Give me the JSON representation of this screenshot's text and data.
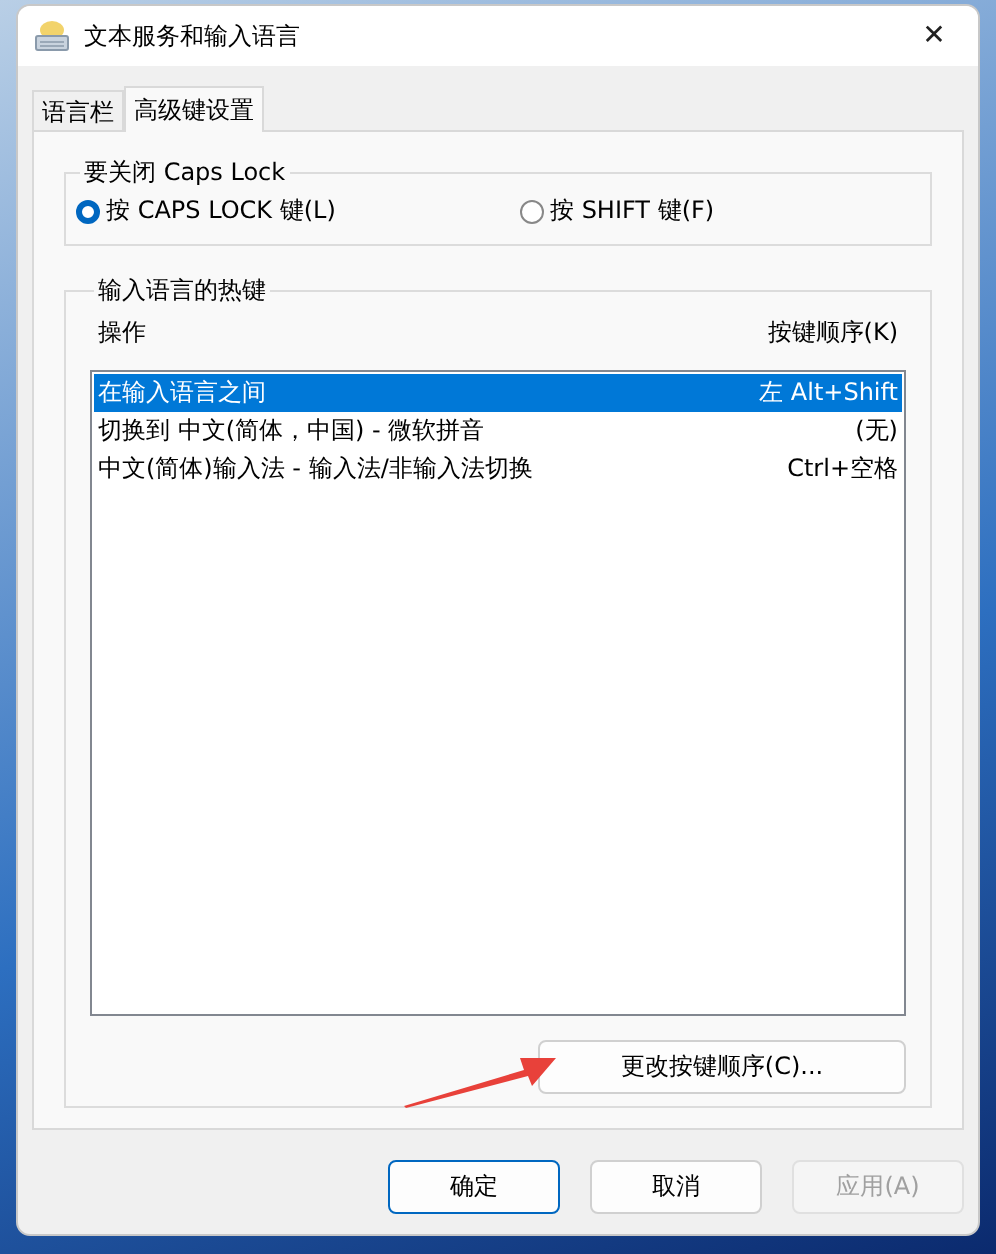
{
  "window": {
    "title": "文本服务和输入语言",
    "close": "✕"
  },
  "tabs": [
    {
      "label": "语言栏",
      "selected": false
    },
    {
      "label": "高级键设置",
      "selected": true
    }
  ],
  "caps_lock_group": {
    "title": "要关闭 Caps Lock",
    "options": [
      {
        "label": "按 CAPS LOCK 键(L)",
        "selected": true
      },
      {
        "label": "按 SHIFT 键(F)",
        "selected": false
      }
    ]
  },
  "hotkeys_group": {
    "title": "输入语言的热键",
    "columns": [
      "操作",
      "按键顺序(K)"
    ],
    "rows": [
      {
        "action": "在输入语言之间",
        "keys": "左 Alt+Shift",
        "selected": true
      },
      {
        "action": "切换到 中文(简体，中国) - 微软拼音",
        "keys": "(无)",
        "selected": false
      },
      {
        "action": "中文(简体)输入法 - 输入法/非输入法切换",
        "keys": "Ctrl+空格",
        "selected": false
      }
    ],
    "change_button": "更改按键顺序(C)..."
  },
  "buttons": [
    {
      "label": "确定",
      "kind": "default",
      "disabled": false
    },
    {
      "label": "取消",
      "kind": "normal",
      "disabled": false
    },
    {
      "label": "应用(A)",
      "kind": "normal",
      "disabled": true
    }
  ]
}
